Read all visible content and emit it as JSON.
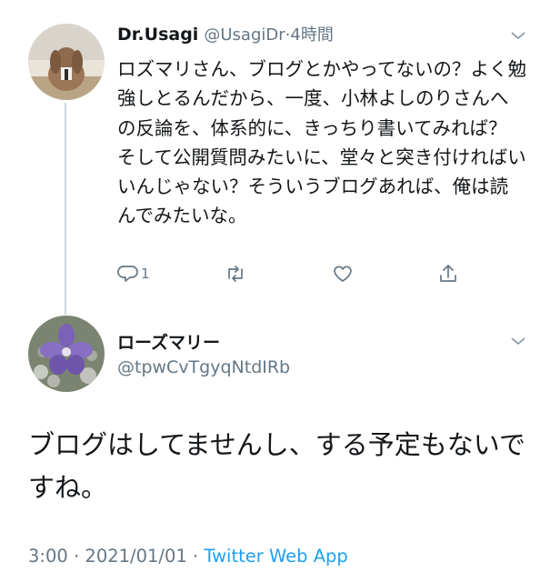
{
  "tweet1": {
    "display_name": "Dr.Usagi",
    "handle": "@UsagiDr",
    "separator": "·",
    "time": "4時間",
    "text": "ロズマリさん、ブログとかやってないの？よく勉強しとるんだから、一度、小林よしのりさんへの反論を、体系的に、きっちり書いてみれば？　そして公開質問みたいに、堂々と突き付ければいいんじゃない？そういうブログあれば、俺は読んでみたいな。",
    "reply_count": "1",
    "icons": [
      "reply-icon",
      "retweet-icon",
      "like-icon",
      "share-icon"
    ]
  },
  "tweet2": {
    "display_name": "ローズマリー",
    "handle": "@tpwCvTgyqNtdIRb",
    "text": "ブログはしてませんし、する予定もないですね。",
    "time": "3:00",
    "sep1": "·",
    "date": "2021/01/01",
    "sep2": "·",
    "source": "Twitter Web App"
  },
  "colors": {
    "secondary_text": "#657786",
    "link": "#1da1f2",
    "thread_line": "#ccd6dd"
  }
}
